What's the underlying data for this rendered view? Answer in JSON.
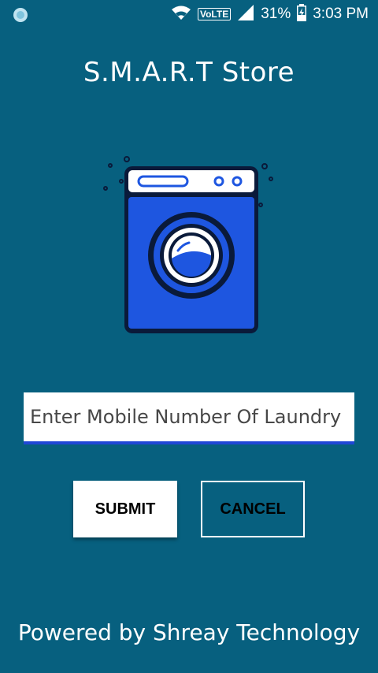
{
  "status_bar": {
    "battery": "31%",
    "time": "3:03 PM",
    "network_badge": "VoLTE",
    "icons": [
      "app-notification-icon",
      "wifi-icon",
      "signal-icon",
      "battery-charging-icon"
    ]
  },
  "app": {
    "title": "S.M.A.R.T Store"
  },
  "illustration": {
    "icon": "washing-machine-icon"
  },
  "form": {
    "mobile_placeholder": "Enter Mobile Number Of Laundry",
    "mobile_value": "",
    "submit_label": "SUBMIT",
    "cancel_label": "CANCEL"
  },
  "footer": {
    "text": "Powered by Shreay Technology"
  },
  "colors": {
    "background": "#07607f",
    "accent": "#1f47d6",
    "machine_body": "#1e56e0"
  }
}
